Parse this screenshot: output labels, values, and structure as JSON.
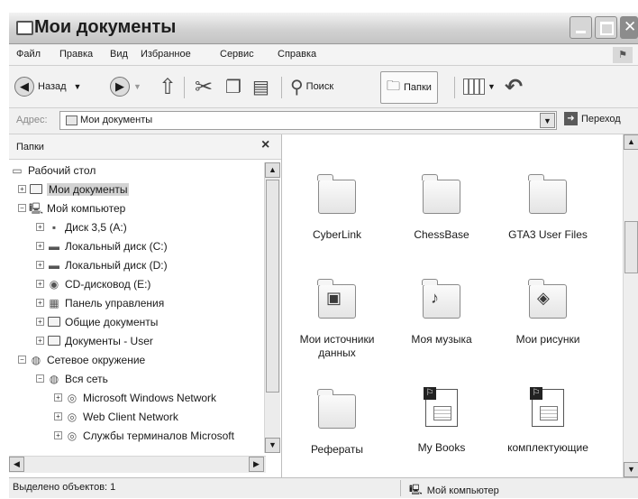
{
  "window": {
    "title": "Мои документы"
  },
  "menu": [
    "Файл",
    "Правка",
    "Вид",
    "Избранное",
    "Сервис",
    "Справка"
  ],
  "toolbar": {
    "back_label": "Назад",
    "search_label": "Поиск",
    "folders_label": "Папки"
  },
  "address": {
    "label": "Адрес:",
    "value": "Мои документы",
    "go_label": "Переход"
  },
  "folders_pane": {
    "title": "Папки",
    "tree": [
      {
        "label": "Рабочий стол",
        "icon": "desktop-icon",
        "expander": ""
      },
      {
        "label": "Мои документы",
        "icon": "folder-icon",
        "expander": "+",
        "selected": true
      },
      {
        "label": "Мой компьютер",
        "icon": "computer-icon",
        "expander": "−"
      },
      {
        "label": "Диск 3,5 (A:)",
        "icon": "floppy-icon",
        "expander": "+"
      },
      {
        "label": "Локальный диск (C:)",
        "icon": "harddisk-icon",
        "expander": "+"
      },
      {
        "label": "Локальный диск (D:)",
        "icon": "harddisk-icon",
        "expander": "+"
      },
      {
        "label": "CD-дисковод (E:)",
        "icon": "cdrom-icon",
        "expander": "+"
      },
      {
        "label": "Панель управления",
        "icon": "control-panel-icon",
        "expander": "+"
      },
      {
        "label": "Общие документы",
        "icon": "folder-icon",
        "expander": "+"
      },
      {
        "label": "Документы - User",
        "icon": "folder-icon",
        "expander": "+"
      },
      {
        "label": "Сетевое окружение",
        "icon": "network-icon",
        "expander": "−"
      },
      {
        "label": "Вся сеть",
        "icon": "network-icon",
        "expander": "−"
      },
      {
        "label": "Microsoft Windows Network",
        "icon": "globe-icon",
        "expander": "+"
      },
      {
        "label": "Web Client Network",
        "icon": "globe-icon",
        "expander": "+"
      },
      {
        "label": "Службы терминалов Microsoft",
        "icon": "globe-icon",
        "expander": "+"
      }
    ]
  },
  "files": [
    {
      "label": "CyberLink",
      "icon": "folder-icon"
    },
    {
      "label": "ChessBase",
      "icon": "folder-icon"
    },
    {
      "label": "GTA3 User Files",
      "icon": "folder-icon"
    },
    {
      "label": "Мои источники данных",
      "icon": "data-sources-folder-icon"
    },
    {
      "label": "Моя музыка",
      "icon": "music-folder-icon"
    },
    {
      "label": "Мои рисунки",
      "icon": "pictures-folder-icon"
    },
    {
      "label": "Рефераты",
      "icon": "folder-icon"
    },
    {
      "label": "My Books",
      "icon": "document-shortcut-icon"
    },
    {
      "label": "комплектующие",
      "icon": "document-shortcut-icon"
    }
  ],
  "status": {
    "left": "Выделено объектов: 1",
    "right": "Мой компьютер"
  }
}
